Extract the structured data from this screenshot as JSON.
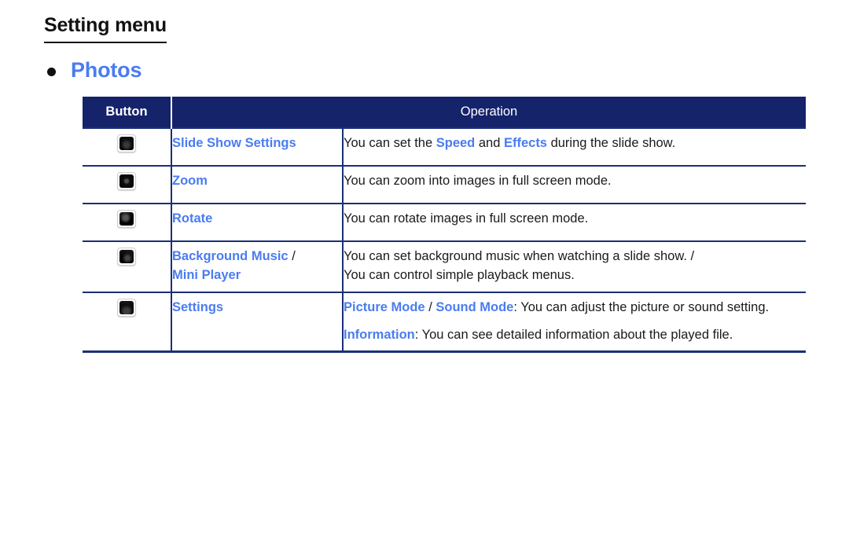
{
  "page": {
    "title": "Setting menu",
    "section": {
      "bullet_icon": "bullet-disc-icon",
      "label": "Photos"
    }
  },
  "colors": {
    "accent_blue": "#4a7cf0",
    "header_navy": "#15236b",
    "border_navy": "#1b2f79",
    "text_black": "#1a1a1a",
    "page_background": "#ffffff"
  },
  "table": {
    "headers": {
      "button": "Button",
      "operation": "Operation"
    },
    "rows": [
      {
        "button_icon": "remote-button-icon",
        "name": "Slide Show Settings",
        "name_parts": [
          {
            "text": "Slide Show Settings",
            "style": "accent"
          }
        ],
        "operation": [
          [
            {
              "text": "You can set the ",
              "style": "plain"
            },
            {
              "text": "Speed",
              "style": "accent"
            },
            {
              "text": " and ",
              "style": "plain"
            },
            {
              "text": "Effects",
              "style": "accent"
            },
            {
              "text": " during the slide show.",
              "style": "plain"
            }
          ]
        ]
      },
      {
        "button_icon": "remote-button-zoom-icon",
        "name": "Zoom",
        "name_parts": [
          {
            "text": "Zoom",
            "style": "accent"
          }
        ],
        "operation": [
          [
            {
              "text": "You can zoom into images in full screen mode.",
              "style": "plain"
            }
          ]
        ]
      },
      {
        "button_icon": "remote-button-rotate-icon",
        "name": "Rotate",
        "name_parts": [
          {
            "text": "Rotate",
            "style": "accent"
          }
        ],
        "operation": [
          [
            {
              "text": "You can rotate images in full screen mode.",
              "style": "plain"
            }
          ]
        ]
      },
      {
        "button_icon": "remote-button-music-icon",
        "name": "Background Music / Mini Player",
        "name_parts": [
          {
            "text": "Background Music",
            "style": "accent"
          },
          {
            "text": " /",
            "style": "plain"
          },
          {
            "text": " ",
            "style": "linebreak"
          },
          {
            "text": "Mini Player",
            "style": "accent"
          }
        ],
        "operation": [
          [
            {
              "text": "You can set background music when watching a slide show. /",
              "style": "plain"
            },
            {
              "text": " ",
              "style": "linebreak"
            },
            {
              "text": "You can control simple playback menus.",
              "style": "plain"
            }
          ]
        ]
      },
      {
        "button_icon": "remote-button-settings-icon",
        "name": "Settings",
        "name_parts": [
          {
            "text": "Settings",
            "style": "accent"
          }
        ],
        "operation": [
          [
            {
              "text": "Picture Mode",
              "style": "accent"
            },
            {
              "text": " / ",
              "style": "plain"
            },
            {
              "text": "Sound Mode",
              "style": "accent"
            },
            {
              "text": ": You can adjust the picture or sound setting.",
              "style": "plain"
            }
          ],
          [
            {
              "text": "Information",
              "style": "accent"
            },
            {
              "text": ": You can see detailed information about the played file.",
              "style": "plain"
            }
          ]
        ]
      }
    ]
  }
}
